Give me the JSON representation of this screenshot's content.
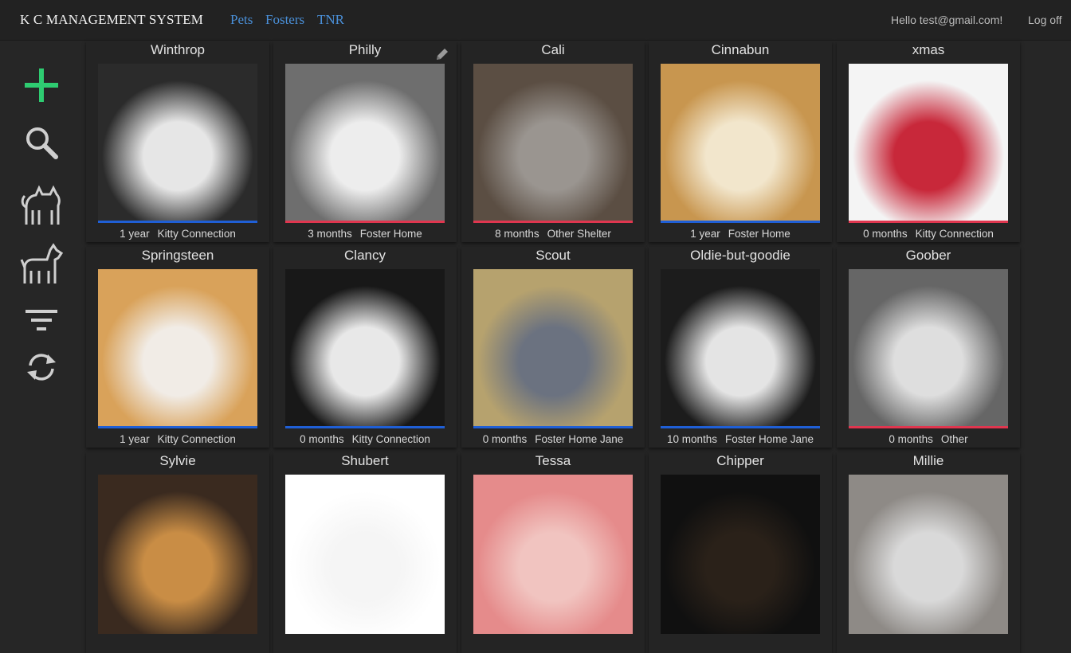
{
  "header": {
    "brand": "K C MANAGEMENT SYSTEM",
    "nav": [
      "Pets",
      "Fosters",
      "TNR"
    ],
    "greeting": "Hello test@gmail.com!",
    "logoff": "Log off"
  },
  "sidebar": {
    "items": [
      {
        "icon": "plus-icon",
        "color": "#2ecc71"
      },
      {
        "icon": "search-icon",
        "color": "#cccccc"
      },
      {
        "icon": "cat-icon",
        "color": "#cccccc"
      },
      {
        "icon": "dog-icon",
        "color": "#cccccc"
      },
      {
        "icon": "filter-icon",
        "color": "#cccccc"
      },
      {
        "icon": "refresh-icon",
        "color": "#cccccc"
      }
    ]
  },
  "status_colors": {
    "blue": "#1f5fd6",
    "red": "#e0364f"
  },
  "pets": [
    {
      "name": "Winthrop",
      "age": "1 year",
      "location": "Kitty Connection",
      "status": "blue",
      "tone": [
        "#2b2b2b",
        "#e6e6e6"
      ]
    },
    {
      "name": "Philly",
      "age": "3 months",
      "location": "Foster Home",
      "status": "red",
      "tone": [
        "#6e6e6e",
        "#ededed"
      ]
    },
    {
      "name": "Cali",
      "age": "8 months",
      "location": "Other Shelter",
      "status": "red",
      "tone": [
        "#5b4e43",
        "#9a9590"
      ]
    },
    {
      "name": "Cinnabun",
      "age": "1 year",
      "location": "Foster Home",
      "status": "blue",
      "tone": [
        "#c8964f",
        "#f2e6cc"
      ]
    },
    {
      "name": "xmas",
      "age": "0 months",
      "location": "Kitty Connection",
      "status": "red",
      "tone": [
        "#f4f4f4",
        "#c8283a"
      ]
    },
    {
      "name": "Springsteen",
      "age": "1 year",
      "location": "Kitty Connection",
      "status": "blue",
      "tone": [
        "#d9a25a",
        "#f1ece6"
      ]
    },
    {
      "name": "Clancy",
      "age": "0 months",
      "location": "Kitty Connection",
      "status": "blue",
      "tone": [
        "#181818",
        "#e8e8e8"
      ]
    },
    {
      "name": "Scout",
      "age": "0 months",
      "location": "Foster Home Jane",
      "status": "blue",
      "tone": [
        "#b6a26e",
        "#6b7280"
      ]
    },
    {
      "name": "Oldie-but-goodie",
      "age": "10 months",
      "location": "Foster Home Jane",
      "status": "blue",
      "tone": [
        "#1c1c1c",
        "#e4e4e4"
      ]
    },
    {
      "name": "Goober",
      "age": "0 months",
      "location": "Other",
      "status": "red",
      "tone": [
        "#666666",
        "#dedede"
      ]
    },
    {
      "name": "Sylvie",
      "age": "",
      "location": "",
      "status": "",
      "tone": [
        "#3a2a1f",
        "#c98d45"
      ]
    },
    {
      "name": "Shubert",
      "age": "",
      "location": "",
      "status": "",
      "tone": [
        "#ffffff",
        "#f5f5f5"
      ]
    },
    {
      "name": "Tessa",
      "age": "",
      "location": "",
      "status": "",
      "tone": [
        "#e58b8b",
        "#f1c4c0"
      ]
    },
    {
      "name": "Chipper",
      "age": "",
      "location": "",
      "status": "",
      "tone": [
        "#101010",
        "#2a2119"
      ]
    },
    {
      "name": "Millie",
      "age": "",
      "location": "",
      "status": "",
      "tone": [
        "#8e8a86",
        "#d9d9d9"
      ]
    }
  ]
}
